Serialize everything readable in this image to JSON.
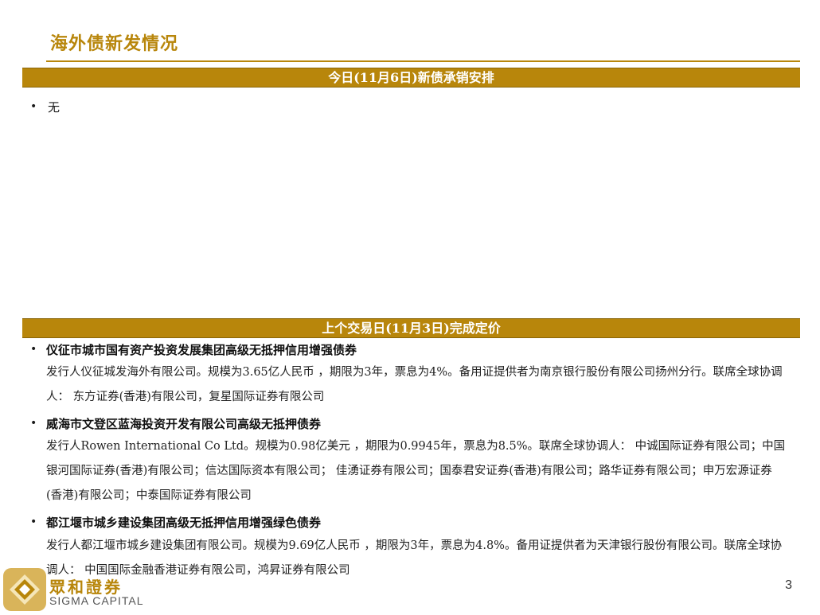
{
  "page": {
    "title": "海外债新发情况",
    "number": "3"
  },
  "today_section": {
    "header": "今日(11月6日)新债承销安排",
    "items": [
      {
        "text": "无"
      }
    ]
  },
  "last_section": {
    "header": "上个交易日(11月3日)完成定价",
    "bonds": [
      {
        "title": "仪征市城市国有资产投资发展集团高级无抵押信用增强债券",
        "body": "发行人仪征城发海外有限公司。规模为3.65亿人民币 ，期限为3年，票息为4%。备用证提供者为南京银行股份有限公司扬州分行。联席全球协调人： 东方证券(香港)有限公司，复星国际证券有限公司"
      },
      {
        "title": "威海市文登区蓝海投资开发有限公司高级无抵押债券",
        "body": "发行人Rowen International Co Ltd。规模为0.98亿美元 ，期限为0.9945年，票息为8.5%。联席全球协调人： 中诚国际证券有限公司；中国银河国际证券(香港)有限公司；信达国际资本有限公司； 佳湧证券有限公司；国泰君安证券(香港)有限公司；路华证券有限公司；申万宏源证券(香港)有限公司；中泰国际证券有限公司"
      },
      {
        "title": "都江堰市城乡建设集团高级无抵押信用增强绿色债券",
        "body": "发行人都江堰市城乡建设集团有限公司。规模为9.69亿人民币 ，期限为3年，票息为4.8%。备用证提供者为天津银行股份有限公司。联席全球协调人： 中国国际金融香港证券有限公司，鸿昇证券有限公司"
      }
    ]
  },
  "brand": {
    "name_cn": "眾和證券",
    "name_en": "SIGMA CAPITAL",
    "logo_icon": "sigma-capital-logo",
    "accent_color": "#b8860b"
  }
}
